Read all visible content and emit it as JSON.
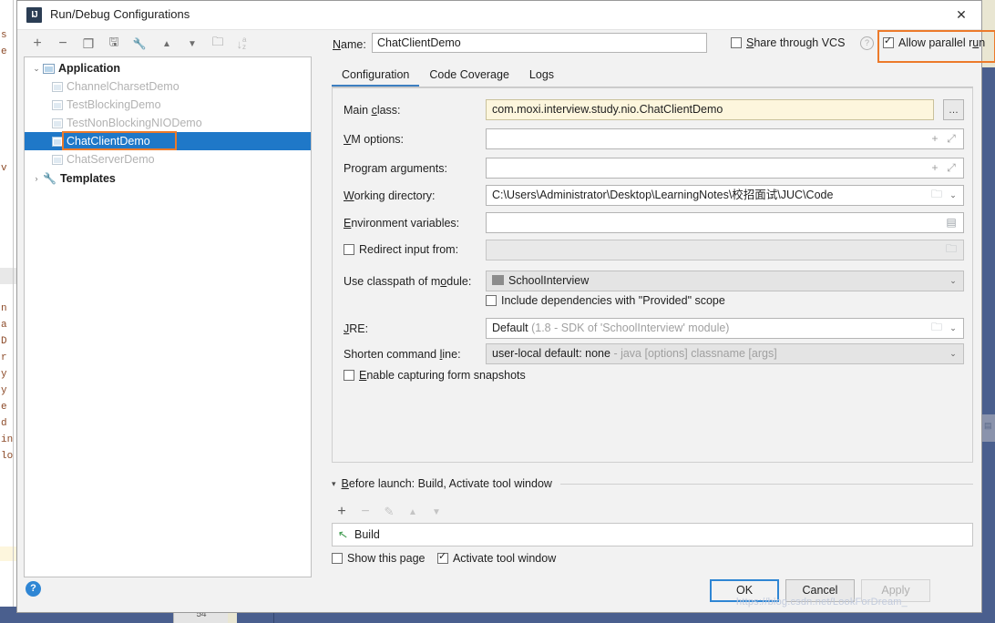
{
  "window": {
    "title": "Run/Debug Configurations",
    "app_icon": "intellij-idea-icon",
    "close_icon": "✕"
  },
  "toolbar": {
    "buttons": [
      {
        "name": "add-configuration-button",
        "glyph": "+",
        "label": "Add New Configuration"
      },
      {
        "name": "remove-configuration-button",
        "glyph": "−",
        "label": "Remove Configuration"
      },
      {
        "name": "copy-configuration-button",
        "glyph": "❐",
        "label": "Copy Configuration"
      },
      {
        "name": "save-configuration-button",
        "glyph": "🖫",
        "label": "Save Configuration"
      },
      {
        "name": "edit-templates-button",
        "glyph": "🔧",
        "label": "Edit Templates"
      },
      {
        "name": "move-up-button",
        "glyph": "▲",
        "label": "Move Up"
      },
      {
        "name": "move-down-button",
        "glyph": "▼",
        "label": "Move Down"
      },
      {
        "name": "new-folder-button",
        "glyph": "🗀",
        "label": "Create New Folder"
      },
      {
        "name": "sort-configurations-button",
        "glyph": "↓",
        "label": "Sort Configurations"
      }
    ]
  },
  "tree": {
    "nodes": [
      {
        "label": "Application",
        "type": "group",
        "expanded": true,
        "arrow": "⌄",
        "bold": true,
        "dim": false,
        "selected": false
      },
      {
        "label": "ChannelCharsetDemo",
        "type": "config",
        "dim": true,
        "selected": false
      },
      {
        "label": "TestBlockingDemo",
        "type": "config",
        "dim": true,
        "selected": false
      },
      {
        "label": "TestNonBlockingNIODemo",
        "type": "config",
        "dim": true,
        "selected": false
      },
      {
        "label": "ChatClientDemo",
        "type": "config",
        "dim": false,
        "selected": true
      },
      {
        "label": "ChatServerDemo",
        "type": "config",
        "dim": true,
        "selected": false
      },
      {
        "label": "Templates",
        "type": "templates",
        "expanded": false,
        "arrow": "›",
        "bold": true,
        "dim": false,
        "selected": false
      }
    ]
  },
  "name_row": {
    "label": "Name:",
    "value": "ChatClientDemo",
    "share_vcs_label": "Share through VCS",
    "share_vcs_checked": false,
    "help_glyph": "?",
    "allow_parallel_label": "Allow parallel run",
    "allow_parallel_checked": true
  },
  "tabs": [
    {
      "label": "Configuration",
      "active": true
    },
    {
      "label": "Code Coverage",
      "active": false
    },
    {
      "label": "Logs",
      "active": false
    }
  ],
  "form": {
    "main_class": {
      "label": "Main class:",
      "value": "com.moxi.interview.study.nio.ChatClientDemo",
      "browse_glyph": "…"
    },
    "vm_options": {
      "label": "VM options:",
      "value": "",
      "macro_glyph": "+",
      "expand_glyph": "⤢"
    },
    "program_arguments": {
      "label": "Program arguments:",
      "value": "",
      "macro_glyph": "+",
      "expand_glyph": "⤢"
    },
    "working_directory": {
      "label": "Working directory:",
      "value": "C:\\Users\\Administrator\\Desktop\\LearningNotes\\校招面试\\JUC\\Code",
      "folder_glyph": "🗀",
      "chevron_glyph": "⌄"
    },
    "environment_variables": {
      "label": "Environment variables:",
      "value": "",
      "editor_glyph": "▤"
    },
    "redirect_input": {
      "label": "Redirect input from:",
      "checked": false,
      "value": "",
      "folder_glyph": "🗀"
    },
    "use_classpath": {
      "label": "Use classpath of module:",
      "value": "SchoolInterview",
      "chevron_glyph": "⌄",
      "module_icon": "module-icon"
    },
    "include_provided": {
      "label": "Include dependencies with \"Provided\" scope",
      "checked": false
    },
    "jre": {
      "label": "JRE:",
      "value": "Default",
      "hint": "(1.8 - SDK of 'SchoolInterview' module)",
      "folder_glyph": "🗀",
      "chevron_glyph": "⌄"
    },
    "shorten_command_line": {
      "label": "Shorten command line:",
      "value": "user-local default: none",
      "hint": "- java [options] classname [args]",
      "chevron_glyph": "⌄"
    },
    "enable_snapshots": {
      "label": "Enable capturing form snapshots",
      "checked": false
    }
  },
  "before_launch": {
    "arrow": "▾",
    "title_prefix": "B",
    "title": "efore launch: Build, Activate tool window",
    "toolbar": [
      {
        "name": "bl-add-button",
        "glyph": "+",
        "enabled": true
      },
      {
        "name": "bl-remove-button",
        "glyph": "−",
        "enabled": false
      },
      {
        "name": "bl-edit-button",
        "glyph": "✎",
        "enabled": false
      },
      {
        "name": "bl-move-up-button",
        "glyph": "▲",
        "enabled": false
      },
      {
        "name": "bl-move-down-button",
        "glyph": "▼",
        "enabled": false
      }
    ],
    "items": [
      {
        "label": "Build",
        "icon": "build-hammer-icon"
      }
    ],
    "show_this_page": {
      "label": "Show this page",
      "checked": false
    },
    "activate_tool_window": {
      "label": "Activate tool window",
      "checked": true
    }
  },
  "footer": {
    "help_glyph": "?",
    "ok_label": "OK",
    "cancel_label": "Cancel",
    "apply_label": "Apply",
    "apply_disabled": true
  },
  "watermark": {
    "text": "https://blog.csdn.net/LookForDream_"
  },
  "background": {
    "code_sliver": "s\ne\n\n\nv\n\n\n\nn\na\nD\nr\ny\ny\ne\nd\nin\nlo",
    "status_tab": "54"
  },
  "colors": {
    "highlight_orange": "#ec7a2a",
    "selection_blue": "#1f78c8",
    "accent_blue": "#3d7fc1",
    "field_yellow": "#fdf6dd",
    "desktop_blue": "#4a5f8e"
  }
}
